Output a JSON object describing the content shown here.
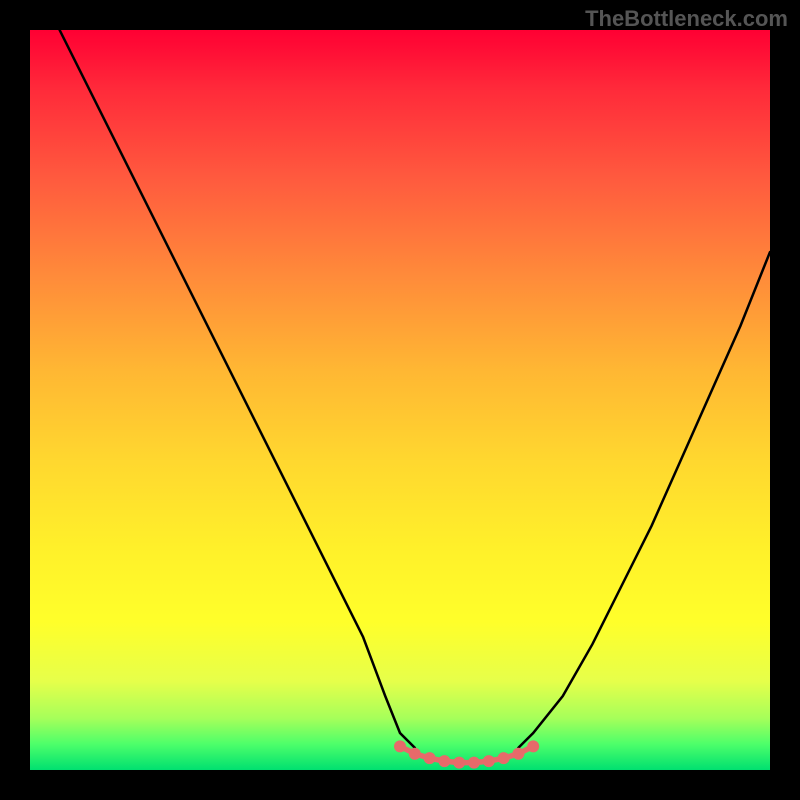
{
  "watermark": "TheBottleneck.com",
  "colors": {
    "background": "#000000",
    "curve_stroke": "#000000",
    "marker_fill": "#e76a6a",
    "gradient_stops": [
      {
        "pct": 0,
        "hex": "#ff0033"
      },
      {
        "pct": 8,
        "hex": "#ff2a3a"
      },
      {
        "pct": 20,
        "hex": "#ff5a3e"
      },
      {
        "pct": 33,
        "hex": "#ff8a3a"
      },
      {
        "pct": 46,
        "hex": "#ffb733"
      },
      {
        "pct": 58,
        "hex": "#ffd72f"
      },
      {
        "pct": 70,
        "hex": "#fff02a"
      },
      {
        "pct": 80,
        "hex": "#ffff2a"
      },
      {
        "pct": 88,
        "hex": "#e6ff4a"
      },
      {
        "pct": 93,
        "hex": "#a6ff5a"
      },
      {
        "pct": 96.5,
        "hex": "#4dff6a"
      },
      {
        "pct": 100,
        "hex": "#00e070"
      }
    ]
  },
  "chart_data": {
    "type": "line",
    "title": "",
    "xlabel": "",
    "ylabel": "",
    "xlim": [
      0,
      100
    ],
    "ylim": [
      0,
      100
    ],
    "grid": false,
    "series": [
      {
        "name": "left-curve",
        "x": [
          4,
          10,
          15,
          20,
          25,
          30,
          35,
          40,
          45,
          48,
          50,
          52
        ],
        "y": [
          100,
          88,
          78,
          68,
          58,
          48,
          38,
          28,
          18,
          10,
          5,
          3
        ]
      },
      {
        "name": "right-curve",
        "x": [
          66,
          68,
          72,
          76,
          80,
          84,
          88,
          92,
          96,
          100
        ],
        "y": [
          3,
          5,
          10,
          17,
          25,
          33,
          42,
          51,
          60,
          70
        ]
      }
    ],
    "markers": {
      "name": "bottom-markers",
      "color": "#e76a6a",
      "x": [
        50,
        52,
        54,
        56,
        58,
        60,
        62,
        64,
        66,
        68
      ],
      "y": [
        3.2,
        2.2,
        1.6,
        1.2,
        1.0,
        1.0,
        1.2,
        1.6,
        2.2,
        3.2
      ]
    },
    "marker_line": {
      "name": "bottom-connector",
      "color": "#e76a6a",
      "x": [
        50,
        52,
        54,
        56,
        58,
        60,
        62,
        64,
        66,
        68
      ],
      "y": [
        3.2,
        2.2,
        1.6,
        1.2,
        1.0,
        1.0,
        1.2,
        1.6,
        2.2,
        3.2
      ]
    }
  }
}
